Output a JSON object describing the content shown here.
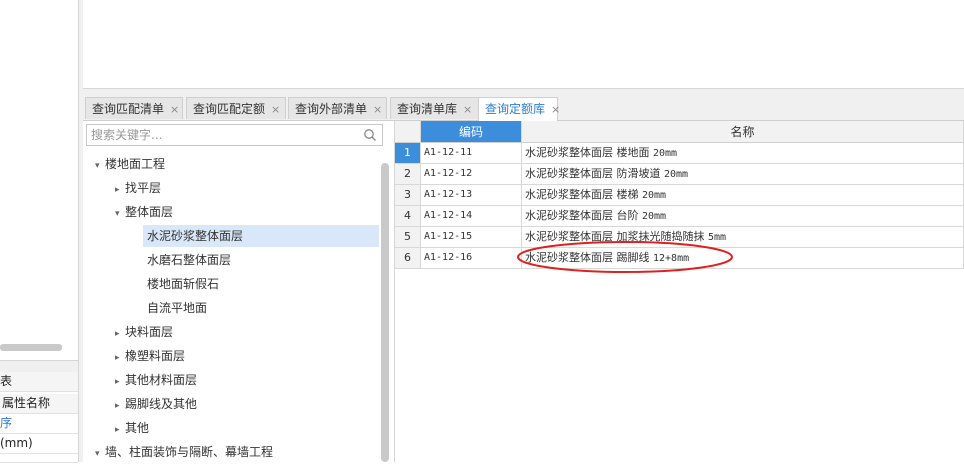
{
  "left_panel": {
    "header": "表",
    "col_header": "属性名称",
    "row_blue": "序",
    "row_mm": "(mm)"
  },
  "tabs": [
    {
      "label": "查询匹配清单",
      "close": "×"
    },
    {
      "label": "查询匹配定额",
      "close": "×"
    },
    {
      "label": "查询外部清单",
      "close": "×"
    },
    {
      "label": "查询清单库",
      "close": "×"
    },
    {
      "label": "查询定额库",
      "close": "×"
    }
  ],
  "search": {
    "placeholder": "搜索关键字..."
  },
  "tree": [
    {
      "label": "楼地面工程",
      "arrow": "▾"
    },
    {
      "label": "找平层",
      "arrow": "▸"
    },
    {
      "label": "整体面层",
      "arrow": "▾"
    },
    {
      "label": "水泥砂浆整体面层",
      "arrow": ""
    },
    {
      "label": "水磨石整体面层",
      "arrow": ""
    },
    {
      "label": "楼地面斩假石",
      "arrow": ""
    },
    {
      "label": "自流平地面",
      "arrow": ""
    },
    {
      "label": "块料面层",
      "arrow": "▸"
    },
    {
      "label": "橡塑料面层",
      "arrow": "▸"
    },
    {
      "label": "其他材料面层",
      "arrow": "▸"
    },
    {
      "label": "踢脚线及其他",
      "arrow": "▸"
    },
    {
      "label": "其他",
      "arrow": "▸"
    },
    {
      "label": "墙、柱面装饰与隔断、幕墙工程",
      "arrow": "▾"
    }
  ],
  "grid": {
    "headers": {
      "code": "编码",
      "name": "名称"
    },
    "rows": [
      {
        "no": "1",
        "code": "A1-12-11",
        "name": "水泥砂浆整体面层 楼地面",
        "spec": "20mm"
      },
      {
        "no": "2",
        "code": "A1-12-12",
        "name": "水泥砂浆整体面层 防滑坡道",
        "spec": "20mm"
      },
      {
        "no": "3",
        "code": "A1-12-13",
        "name": "水泥砂浆整体面层 楼梯",
        "spec": "20mm"
      },
      {
        "no": "4",
        "code": "A1-12-14",
        "name": "水泥砂浆整体面层 台阶",
        "spec": "20mm"
      },
      {
        "no": "5",
        "code": "A1-12-15",
        "name": "水泥砂浆整体面层 加浆抹光随捣随抹",
        "spec": "5mm"
      },
      {
        "no": "6",
        "code": "A1-12-16",
        "name": "水泥砂浆整体面层 踢脚线",
        "spec": "12+8mm"
      }
    ]
  },
  "colors": {
    "accent": "#3d8ddd",
    "selected_bg": "#d9e8f8",
    "annotation": "#e02020"
  }
}
